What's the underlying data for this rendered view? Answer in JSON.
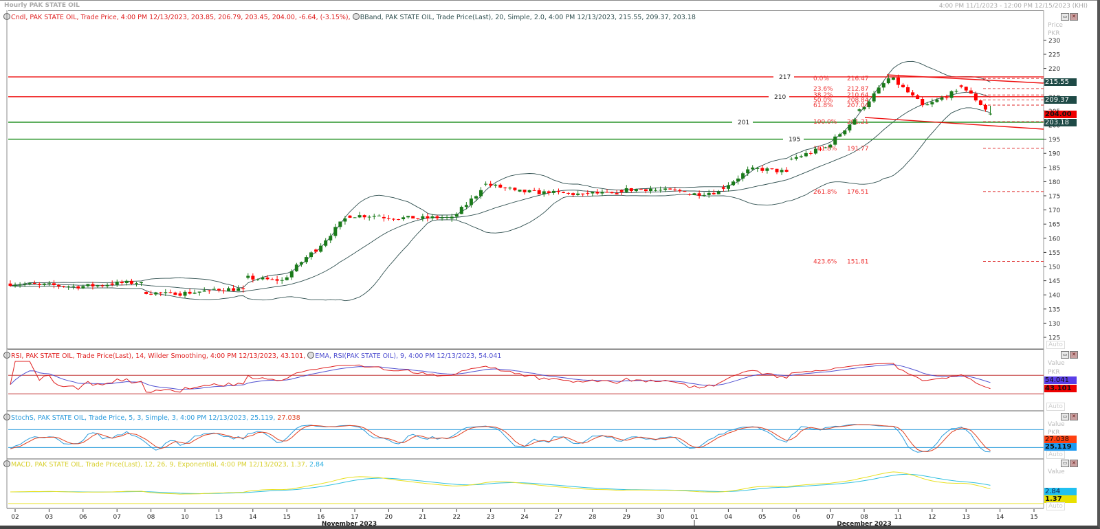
{
  "window": {
    "title": "Hourly PAK STATE OIL",
    "date_range": "4:00 PM 11/1/2023 - 12:00 PM 12/15/2023 (KHI)"
  },
  "colors": {
    "up": "#1a7a1a",
    "down": "#ff0000",
    "band": "#2f4f4f",
    "rsi": "#e02020",
    "rsi_ema": "#5050d0",
    "stoch_k": "#2a9bdc",
    "stoch_d": "#e04020",
    "macd": "#e8e020",
    "signal": "#30c0e0",
    "tag_teal": "#1e4a46"
  },
  "main_panel": {
    "legend_candle": "Cndl, PAK STATE OIL, Trade Price, 4:00 PM 12/13/2023, 203.85, 206.79, 203.45, 204.00, -6.64, (-3.15%),",
    "legend_bband": "BBand, PAK STATE OIL, Trade Price(Last),  20, Simple, 2.0, 4:00 PM 12/13/2023, 215.55, 209.37, 203.18",
    "axis_title": "Price",
    "axis_unit": "PKR",
    "auto_label": "Auto",
    "price_tags": [
      {
        "value": "215.55",
        "kind": "teal"
      },
      {
        "value": "209.37",
        "kind": "teal"
      },
      {
        "value": "204.00",
        "kind": "red"
      },
      {
        "value": "203.18",
        "kind": "teal"
      }
    ],
    "hlines": [
      {
        "label": "217",
        "value": 217,
        "color": "#ee1111"
      },
      {
        "label": "210",
        "value": 210,
        "color": "#ee1111"
      },
      {
        "label": "201",
        "value": 201,
        "color": "#118811"
      },
      {
        "label": "195",
        "value": 195,
        "color": "#118811"
      }
    ],
    "fibonacci": [
      {
        "pct": "0.0%",
        "price": "216.47",
        "value": 216.47
      },
      {
        "pct": "23.6%",
        "price": "212.87",
        "value": 212.87
      },
      {
        "pct": "38.2%",
        "price": "210.64",
        "value": 210.64
      },
      {
        "pct": "50.0%",
        "price": "208.84",
        "value": 208.84
      },
      {
        "pct": "61.8%",
        "price": "207.04",
        "value": 207.04
      },
      {
        "pct": "100.0%",
        "price": "201.21",
        "value": 201.21
      },
      {
        "pct": "161.8%",
        "price": "191.77",
        "value": 191.77
      },
      {
        "pct": "261.8%",
        "price": "176.51",
        "value": 176.51
      },
      {
        "pct": "423.6%",
        "price": "151.81",
        "value": 151.81
      }
    ]
  },
  "rsi_panel": {
    "legend_rsi": "RSI, PAK STATE OIL, Trade Price(Last),  14, Wilder Smoothing,  4:00 PM 12/13/2023, 43.101,",
    "legend_ema": "EMA, RSI(PAK STATE OIL),  9,  4:00 PM 12/13/2023, 54.041",
    "axis_title": "Value",
    "axis_unit": "PKR",
    "tag_ema": "54.041",
    "tag_rsi": "43.101",
    "auto_label": "Auto",
    "levels": [
      70,
      30
    ]
  },
  "stoch_panel": {
    "legend_main": "StochS, PAK STATE OIL, Trade Price,  5, 3, Simple,  3,  4:00 PM 12/13/2023, 25.119,",
    "legend_d": "27.038",
    "axis_title": "Value",
    "axis_unit": "PKR",
    "tag_d": "27.038",
    "tag_k": "25.119",
    "auto_label": "Auto",
    "levels": [
      80,
      20
    ]
  },
  "macd_panel": {
    "legend_main": "MACD, PAK STATE OIL, Trade Price(Last),  12, 26, 9, Exponential,  4:00 PM 12/13/2023, 1.37,",
    "legend_signal": "2.84",
    "axis_title": "Value",
    "tag_signal": "2.84",
    "tag_macd": "1.37",
    "auto_label": "Auto"
  },
  "x_axis": {
    "ticks": [
      "02",
      "03",
      "06",
      "07",
      "08",
      "10",
      "13",
      "14",
      "15",
      "16",
      "17",
      "20",
      "21",
      "22",
      "23",
      "24",
      "27",
      "28",
      "29",
      "30",
      "01",
      "04",
      "05",
      "06",
      "07",
      "08",
      "11",
      "12",
      "13",
      "14",
      "15"
    ],
    "month_labels": [
      {
        "label": "November 2023",
        "tick_index": 10
      },
      {
        "label": "December 2023",
        "tick_index": 25
      }
    ]
  },
  "chart_data": {
    "type": "candlestick",
    "title": "Hourly PAK STATE OIL",
    "ylabel": "Price (PKR)",
    "ylim": [
      122,
      233
    ],
    "y_ticks": [
      125,
      130,
      135,
      140,
      145,
      150,
      155,
      160,
      165,
      170,
      175,
      180,
      185,
      190,
      195,
      200,
      205,
      210,
      215,
      220,
      225,
      230
    ],
    "bars_per_day": 7,
    "daily_open_close": [
      [
        144,
        143.5
      ],
      [
        143.5,
        143
      ],
      [
        143,
        143.5
      ],
      [
        144,
        144.5
      ],
      [
        141,
        140
      ],
      [
        140.5,
        141.5
      ],
      [
        142,
        142
      ],
      [
        146,
        145
      ],
      [
        145,
        155
      ],
      [
        156,
        167
      ],
      [
        168,
        168
      ],
      [
        167.5,
        167
      ],
      [
        167,
        167.5
      ],
      [
        167,
        177
      ],
      [
        179,
        177
      ],
      [
        176.5,
        176
      ],
      [
        176,
        175.5
      ],
      [
        176,
        175.5
      ],
      [
        177,
        177.5
      ],
      [
        177,
        176.5
      ],
      [
        175.5,
        176.5
      ],
      [
        178,
        185
      ],
      [
        184.5,
        183.5
      ],
      [
        188,
        191.5
      ],
      [
        192,
        202
      ],
      [
        205,
        216.5
      ],
      [
        216,
        207
      ],
      [
        207,
        212
      ],
      [
        214,
        204
      ]
    ],
    "last_bar": {
      "open": 203.85,
      "high": 206.79,
      "low": 203.45,
      "close": 204.0
    },
    "bollinger": {
      "period": 20,
      "stddev": 2.0,
      "upper": 215.55,
      "middle": 209.37,
      "lower": 203.18
    }
  }
}
